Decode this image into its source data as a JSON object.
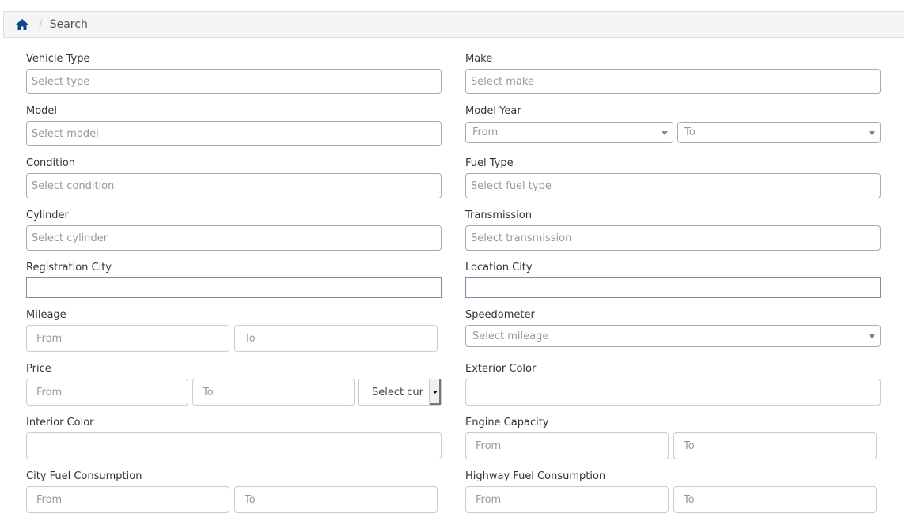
{
  "breadcrumb": {
    "home_icon": "home-icon",
    "separator": "/",
    "current": "Search"
  },
  "form": {
    "vehicle_type": {
      "label": "Vehicle Type",
      "placeholder": "Select type"
    },
    "make": {
      "label": "Make",
      "placeholder": "Select make"
    },
    "model": {
      "label": "Model",
      "placeholder": "Select model"
    },
    "model_year": {
      "label": "Model Year",
      "from": "From",
      "to": "To"
    },
    "condition": {
      "label": "Condition",
      "placeholder": "Select condition"
    },
    "fuel_type": {
      "label": "Fuel Type",
      "placeholder": "Select fuel type"
    },
    "cylinder": {
      "label": "Cylinder",
      "placeholder": "Select cylinder"
    },
    "transmission": {
      "label": "Transmission",
      "placeholder": "Select transmission"
    },
    "registration_city": {
      "label": "Registration City",
      "value": ""
    },
    "location_city": {
      "label": "Location City",
      "value": ""
    },
    "mileage": {
      "label": "Mileage",
      "from": "From",
      "to": "To"
    },
    "speedometer": {
      "label": "Speedometer",
      "placeholder": "Select mileage"
    },
    "price": {
      "label": "Price",
      "from": "From",
      "to": "To",
      "currency": "Select cur"
    },
    "exterior_color": {
      "label": "Exterior Color",
      "value": ""
    },
    "interior_color": {
      "label": "Interior Color",
      "value": ""
    },
    "engine_capacity": {
      "label": "Engine Capacity",
      "from": "From",
      "to": "To"
    },
    "city_fuel": {
      "label": "City Fuel Consumption",
      "from": "From",
      "to": "To"
    },
    "highway_fuel": {
      "label": "Highway Fuel Consumption",
      "from": "From",
      "to": "To"
    }
  },
  "colors": {
    "home_icon": "#0b4a85",
    "breadcrumb_bg": "#f5f5f5"
  }
}
